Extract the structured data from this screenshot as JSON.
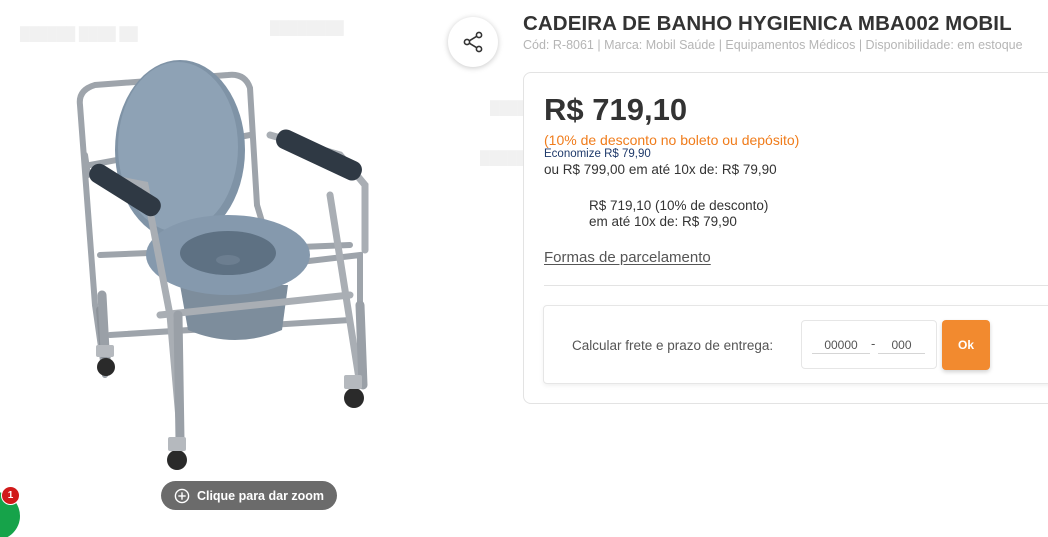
{
  "product": {
    "title": "CADEIRA DE BANHO HYGIENICA MBA002 MOBIL",
    "meta": "Cód: R-8061 | Marca: Mobil Saúde | Equipamentos Médicos | Disponibilidade: em estoque"
  },
  "gallery": {
    "zoom_label": "Clique para dar zoom",
    "zoom_icon": "plus-circle-icon",
    "image_alt": "commode-chair-image"
  },
  "share": {
    "icon": "share-icon"
  },
  "chat": {
    "badge_count": "1",
    "icon": "chat-bubble-icon",
    "color": "#16a34a",
    "badge_color": "#d11a1a"
  },
  "pricing": {
    "price": "R$ 719,10",
    "discount_note": "(10% de desconto no boleto ou depósito)",
    "economize": "Economize R$ 79,90",
    "installments": "ou R$ 799,00 em até 10x de: R$ 79,90",
    "alt_line_1": "R$ 719,10 (10% de desconto)",
    "alt_line_2": "em até 10x de: R$ 79,90",
    "payment_link": "Formas de parcelamento",
    "discount_color": "#f07c1b"
  },
  "shipping": {
    "label": "Calcular frete e prazo de entrega:",
    "cep_part1_placeholder": "00000",
    "cep_separator": "-",
    "cep_part2_placeholder": "000",
    "ok_label": "Ok",
    "ok_color": "#f28a2f"
  }
}
